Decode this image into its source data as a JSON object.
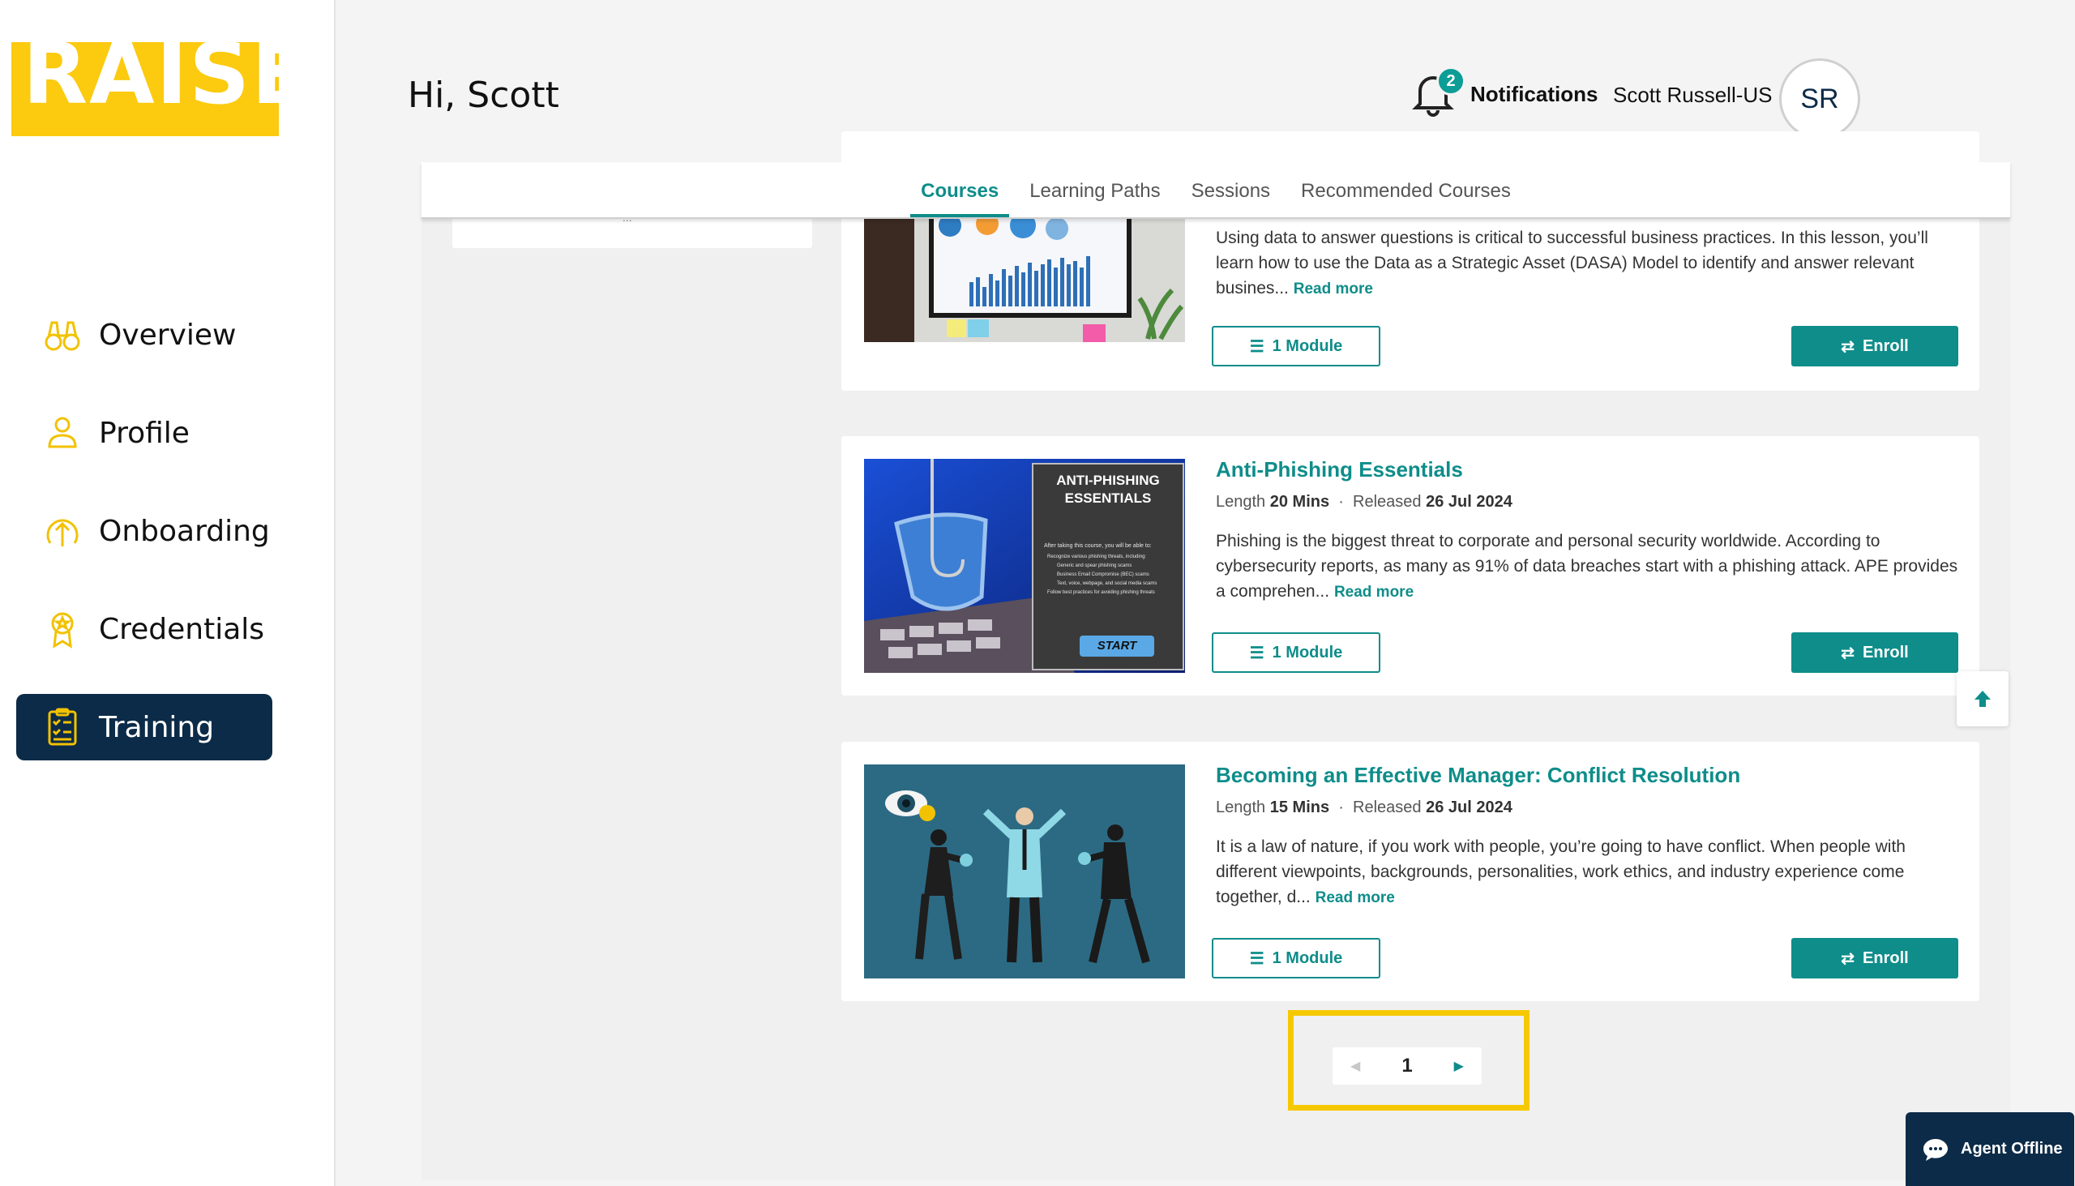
{
  "brand": {
    "logo_text": "RAISE",
    "logo_color": "#fcca0f"
  },
  "sidebar": {
    "items": [
      {
        "label": "Overview",
        "icon": "binoculars-icon",
        "active": false
      },
      {
        "label": "Profile",
        "icon": "person-icon",
        "active": false
      },
      {
        "label": "Onboarding",
        "icon": "upload-circle-icon",
        "active": false
      },
      {
        "label": "Credentials",
        "icon": "award-badge-icon",
        "active": false
      },
      {
        "label": "Training",
        "icon": "clipboard-checklist-icon",
        "active": true
      }
    ]
  },
  "header": {
    "greeting": "Hi, Scott",
    "notifications_label": "Notifications",
    "notifications_count": "2",
    "user_name": "Scott Russell-US",
    "avatar_initials": "SR"
  },
  "tabs": [
    {
      "label": "Courses",
      "active": true
    },
    {
      "label": "Learning Paths",
      "active": false
    },
    {
      "label": "Sessions",
      "active": false
    },
    {
      "label": "Recommended Courses",
      "active": false
    }
  ],
  "filter_panel": {
    "overflow_text": "..."
  },
  "courses": [
    {
      "title": "",
      "description": "Using data to answer questions is critical to successful business practices. In this lesson, you’ll learn how to use the Data as a Strategic Asset (DASA) Model to identify and answer relevant busines...",
      "read_more": "Read more",
      "module_label": "1 Module",
      "enroll_label": "Enroll"
    },
    {
      "title": "Anti-Phishing Essentials",
      "length_label": "Length",
      "length": "20 Mins",
      "released_label": "Released",
      "released": "26 Jul 2024",
      "description": "Phishing is the biggest threat to corporate and personal security worldwide. According to cybersecurity reports, as many as 91% of data breaches start with a phishing attack. APE provides a comprehen...",
      "read_more": "Read more",
      "module_label": "1 Module",
      "enroll_label": "Enroll",
      "thumb": {
        "heading": "ANTI-PHISHING ESSENTIALS",
        "intro": "After taking this course, you will be able to:",
        "bullets": [
          "Recognize various phishing threats, including:",
          "Generic and spear phishing scams",
          "Business Email Compromise (BEC) scams",
          "Text, voice, webpage, and social media scams",
          "Follow best practices for avoiding phishing threats"
        ],
        "start": "START"
      }
    },
    {
      "title": "Becoming an Effective Manager: Conflict Resolution",
      "length_label": "Length",
      "length": "15 Mins",
      "released_label": "Released",
      "released": "26 Jul 2024",
      "description": "It is a law of nature, if you work with people, you’re going to have conflict. When people with different viewpoints, backgrounds, personalities, work ethics, and industry experience come together, d...",
      "read_more": "Read more",
      "module_label": "1 Module",
      "enroll_label": "Enroll"
    }
  ],
  "pagination": {
    "current_page": "1",
    "prev_icon": "caret-left-icon",
    "next_icon": "caret-right-icon"
  },
  "chat": {
    "label": "Agent Offline",
    "icon": "chat-bubble-icon"
  },
  "colors": {
    "accent": "#0e8d8a",
    "navy": "#0c2b48",
    "highlight": "#f6c800"
  }
}
